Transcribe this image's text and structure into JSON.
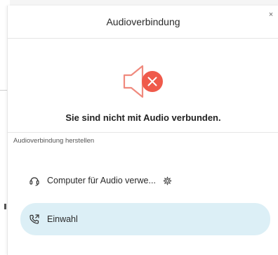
{
  "dialog": {
    "title": "Audioverbindung",
    "close_label": "×",
    "status_message": "Sie sind nicht mit Audio verbunden.",
    "section_label": "Audioverbindung herstellen",
    "options": [
      {
        "label": "Computer für Audio verwe...",
        "icon": "headset-icon"
      },
      {
        "label": "Einwahl",
        "icon": "phone-outgoing-icon"
      }
    ]
  },
  "colors": {
    "error_badge": "#ef5a4b",
    "speaker_outline": "#f08a7e",
    "selected_option_bg": "#dceff6"
  }
}
